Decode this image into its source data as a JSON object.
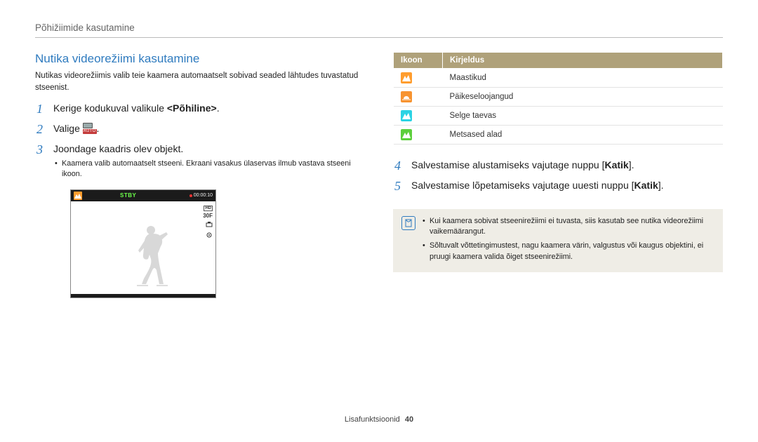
{
  "header": {
    "section": "Põhižiimide kasutamine"
  },
  "page": {
    "title": "Nutika videorežiimi kasutamine",
    "intro": "Nutikas videorežiimis valib teie kaamera automaatselt sobivad seaded lähtudes tuvastatud stseenist.",
    "steps": {
      "s1_pre": "Kerige kodukuval valikule ",
      "s1_bold": "<Põhiline>",
      "s1_post": ".",
      "s2_pre": "Valige ",
      "s2_post": ".",
      "s3": "Joondage kaadris olev objekt.",
      "s3_sub": "Kaamera valib automaatselt stseeni. Ekraani vasakus ülaservas ilmub vastava stseeni ikoon.",
      "s4_pre": "Salvestamise alustamiseks vajutage nuppu [",
      "s4_bold": "Katik",
      "s4_post": "].",
      "s5_pre": "Salvestamise lõpetamiseks vajutage uuesti nuppu [",
      "s5_bold": "Katik",
      "s5_post": "]."
    },
    "auto_icon_label": "AUTO",
    "preview": {
      "stby": "STBY",
      "time": "00:00:10",
      "hd": "HD",
      "fps": "30F"
    }
  },
  "table": {
    "headers": {
      "icon": "Ikoon",
      "desc": "Kirjeldus"
    },
    "rows": [
      {
        "icon": "landscape",
        "color": "orange",
        "label": "Maastikud"
      },
      {
        "icon": "sunset",
        "color": "orange2",
        "label": "Päikeseloojangud"
      },
      {
        "icon": "sky",
        "color": "cyan",
        "label": "Selge taevas"
      },
      {
        "icon": "forest",
        "color": "green",
        "label": "Metsased alad"
      }
    ]
  },
  "note": {
    "items": [
      "Kui kaamera sobivat stseenirežiimi ei tuvasta, siis kasutab see nutika videorežiimi vaikemäärangut.",
      "Sõltuvalt võttetingimustest, nagu kaamera värin, valgustus või kaugus objektini, ei pruugi kaamera valida õiget stseenirežiimi."
    ]
  },
  "footer": {
    "label": "Lisafunktsioonid",
    "page": "40"
  }
}
